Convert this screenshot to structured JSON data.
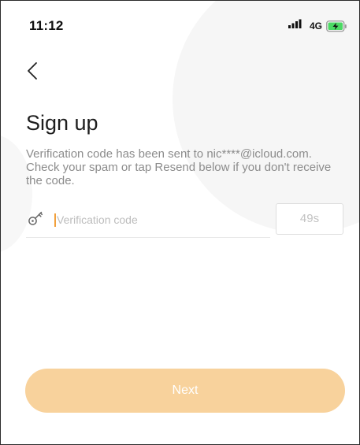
{
  "status_bar": {
    "time": "11:12",
    "signal_icon": "signal-bars-icon",
    "network": "4G",
    "battery_icon": "battery-charging-icon"
  },
  "nav": {
    "back_icon": "chevron-left-icon"
  },
  "page": {
    "title": "Sign up",
    "description": "Verification code has been sent to nic****@icloud.com. Check your spam or tap Resend below if you don't receive the code."
  },
  "form": {
    "code_icon": "key-icon",
    "code_value": "",
    "code_placeholder": "Verification code",
    "timer_label": "49s"
  },
  "actions": {
    "next_label": "Next"
  },
  "colors": {
    "accent": "#f2a03c",
    "button_disabled": "#f8d29c",
    "battery_green": "#4cd964"
  }
}
